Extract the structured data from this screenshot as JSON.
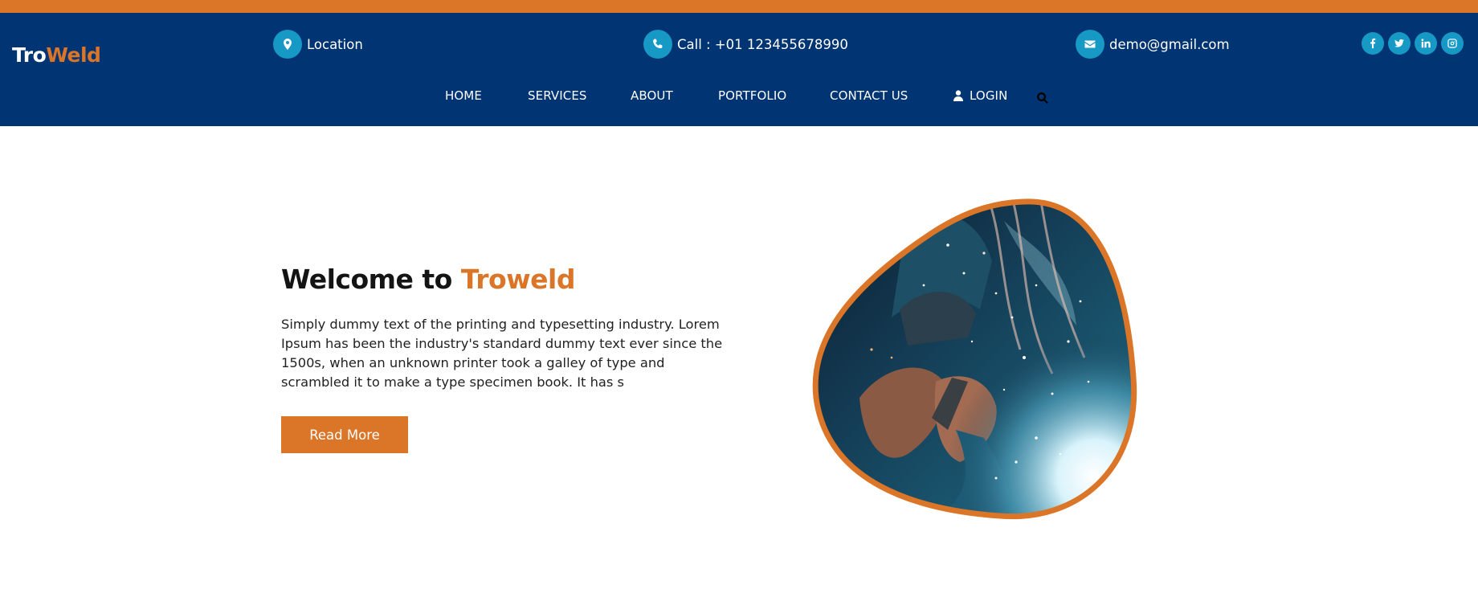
{
  "brand": {
    "part1": "Tro",
    "part2": "Weld"
  },
  "contact": {
    "location": "Location",
    "phone": "Call : +01 123455678990",
    "email": "demo@gmail.com"
  },
  "social": [
    "facebook",
    "twitter",
    "linkedin",
    "instagram"
  ],
  "nav": {
    "home": "HOME",
    "services": "SERVICES",
    "about": "ABOUT",
    "portfolio": "PORTFOLIO",
    "contact": "CONTACT US",
    "login": "LOGIN"
  },
  "hero": {
    "title_prefix": "Welcome to ",
    "title_accent": "Troweld",
    "text": "Simply dummy text of the printing and typesetting industry. Lorem Ipsum has been the industry's standard dummy text ever since the 1500s, when an unknown printer took a galley of type and scrambled it to make a type specimen book. It has s",
    "button": "Read More",
    "image": "welder-sparks-photo"
  },
  "colors": {
    "accent": "#db7528",
    "navy": "#003472",
    "icon_bg": "#1799c6"
  }
}
